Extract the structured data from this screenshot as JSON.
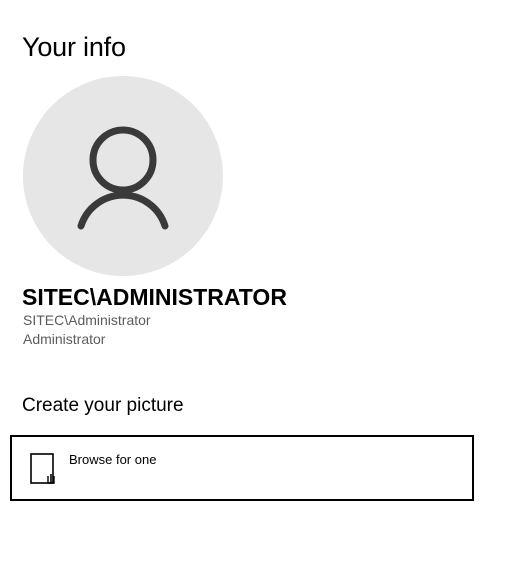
{
  "page": {
    "title": "Your info"
  },
  "user": {
    "display_name": "SITEC\\ADMINISTRATOR",
    "account_name": "SITEC\\Administrator",
    "role": "Administrator",
    "avatar_icon": "person-icon"
  },
  "create_picture": {
    "heading": "Create your picture",
    "browse_label": "Browse for one",
    "browse_icon": "file-icon"
  },
  "colors": {
    "avatar_background": "#e6e6e6",
    "avatar_glyph": "#3a3a3a",
    "secondary_text": "#5c5c5c"
  }
}
